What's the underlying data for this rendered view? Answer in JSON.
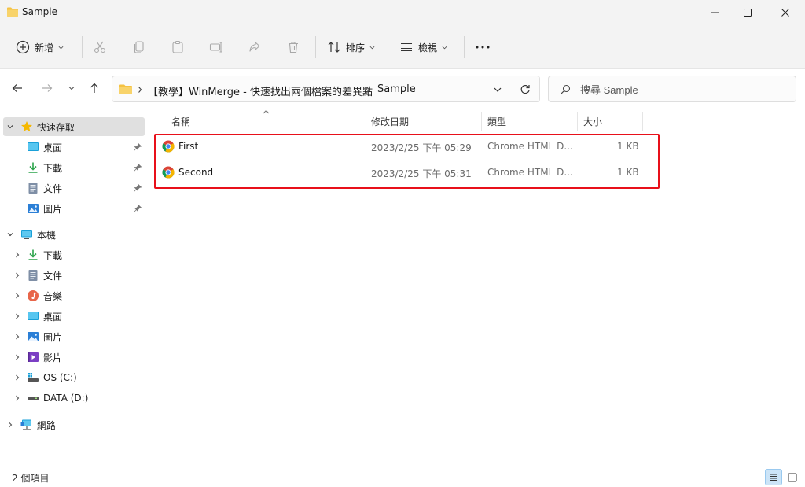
{
  "window": {
    "title": "Sample",
    "icons": {
      "folder": "folder-icon",
      "minimize": "minimize-icon",
      "maximize": "maximize-icon",
      "close": "close-icon"
    }
  },
  "toolbar": {
    "new_label": "新增",
    "sort_label": "排序",
    "view_label": "檢視",
    "icons": [
      "plus-circle-icon",
      "cut-icon",
      "copy-icon",
      "paste-icon",
      "rename-icon",
      "share-icon",
      "delete-icon",
      "sort-icon",
      "view-icon",
      "more-icon"
    ]
  },
  "address": {
    "crumbs": [
      "【教學】WinMerge - 快速找出兩個檔案的差異點",
      "Sample"
    ],
    "search_placeholder": "搜尋 Sample"
  },
  "sidebar": {
    "quick_access": {
      "label": "快速存取",
      "items": [
        {
          "label": "桌面",
          "icon": "desktop-icon"
        },
        {
          "label": "下載",
          "icon": "download-icon"
        },
        {
          "label": "文件",
          "icon": "document-icon"
        },
        {
          "label": "圖片",
          "icon": "pictures-icon"
        }
      ]
    },
    "this_pc": {
      "label": "本機",
      "items": [
        {
          "label": "下載",
          "icon": "download-icon"
        },
        {
          "label": "文件",
          "icon": "document-icon"
        },
        {
          "label": "音樂",
          "icon": "music-icon"
        },
        {
          "label": "桌面",
          "icon": "desktop-icon"
        },
        {
          "label": "圖片",
          "icon": "pictures-icon"
        },
        {
          "label": "影片",
          "icon": "videos-icon"
        },
        {
          "label": "OS (C:)",
          "icon": "drive-c-icon"
        },
        {
          "label": "DATA (D:)",
          "icon": "drive-d-icon"
        }
      ]
    },
    "network": {
      "label": "網路",
      "icon": "network-icon"
    }
  },
  "columns": [
    "名稱",
    "修改日期",
    "類型",
    "大小"
  ],
  "files": [
    {
      "name": "First",
      "modified": "2023/2/25 下午 05:29",
      "type": "Chrome HTML D...",
      "size": "1 KB",
      "icon": "chrome-icon"
    },
    {
      "name": "Second",
      "modified": "2023/2/25 下午 05:31",
      "type": "Chrome HTML D...",
      "size": "1 KB",
      "icon": "chrome-icon"
    }
  ],
  "status": {
    "count_text": "2 個項目",
    "views": [
      "details-view-icon",
      "tiles-view-icon"
    ]
  },
  "colors": {
    "highlight": "#e8101a",
    "accent": "#0067c0",
    "folder": "#f5c242"
  }
}
